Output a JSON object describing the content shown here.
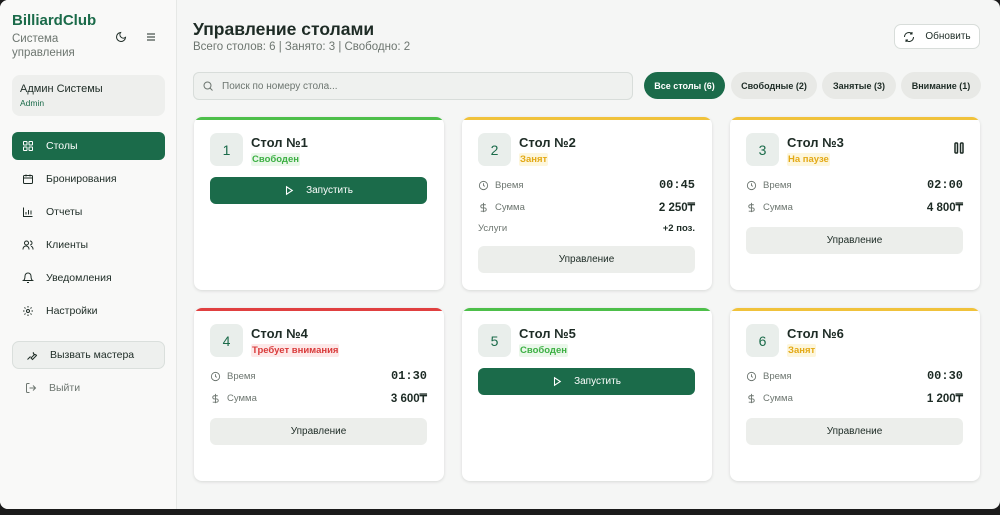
{
  "colors": {
    "accent": "#1b6b4a",
    "free_bar": "#4dbf4a",
    "busy_bar": "#f0c23b",
    "alert_bar": "#e04040",
    "free_text": "#3cb043",
    "busy_text": "#e3a915",
    "alert_text": "#d93a3a",
    "free_bg": "#eaf7ea",
    "busy_bg": "#fdf6dc",
    "alert_bg": "#fde8e8"
  },
  "sidebar": {
    "brand": "BilliardClub",
    "subtitle": "Система управления",
    "theme_icon": "moon-icon",
    "menu_icon": "hamburger-icon",
    "user": {
      "name": "Админ Системы",
      "role": "Admin"
    },
    "items": [
      {
        "label": "Столы",
        "icon": "grid-icon",
        "active": true
      },
      {
        "label": "Бронирования",
        "icon": "calendar-icon",
        "active": false
      },
      {
        "label": "Отчеты",
        "icon": "bar-chart-icon",
        "active": false
      },
      {
        "label": "Клиенты",
        "icon": "users-icon",
        "active": false
      },
      {
        "label": "Уведомления",
        "icon": "bell-icon",
        "active": false
      },
      {
        "label": "Настройки",
        "icon": "gear-icon",
        "active": false
      }
    ],
    "master_label": "Вызвать мастера",
    "logout_label": "Выйти"
  },
  "header": {
    "title": "Управление столами",
    "stats": "Всего столов: 6 | Занято: 3 | Свободно: 2",
    "refresh_label": "Обновить"
  },
  "search": {
    "placeholder": "Поиск по номеру стола..."
  },
  "filters": [
    {
      "label": "Все столы (6)",
      "active": true
    },
    {
      "label": "Свободные (2)",
      "active": false
    },
    {
      "label": "Занятые (3)",
      "active": false
    },
    {
      "label": "Внимание (1)",
      "active": false
    }
  ],
  "tables": [
    {
      "number": "1",
      "name": "Стол №1",
      "status": "Свободен",
      "state": "free",
      "action": "Запустить"
    },
    {
      "number": "2",
      "name": "Стол №2",
      "status": "Занят",
      "state": "busy",
      "time_label": "Время",
      "time": "00:45",
      "sum_label": "Сумма",
      "sum": "2 250₸",
      "services_label": "Услуги",
      "services": "+2 поз.",
      "action": "Управление"
    },
    {
      "number": "3",
      "name": "Стол №3",
      "status": "На паузе",
      "state": "busy",
      "time_label": "Время",
      "time": "02:00",
      "sum_label": "Сумма",
      "sum": "4 800₸",
      "action": "Управление"
    },
    {
      "number": "4",
      "name": "Стол №4",
      "status": "Требует внимания",
      "state": "alert",
      "time_label": "Время",
      "time": "01:30",
      "sum_label": "Сумма",
      "sum": "3 600₸",
      "action": "Управление"
    },
    {
      "number": "5",
      "name": "Стол №5",
      "status": "Свободен",
      "state": "free",
      "action": "Запустить"
    },
    {
      "number": "6",
      "name": "Стол №6",
      "status": "Занят",
      "state": "busy",
      "time_label": "Время",
      "time": "00:30",
      "sum_label": "Сумма",
      "sum": "1 200₸",
      "action": "Управление"
    }
  ]
}
